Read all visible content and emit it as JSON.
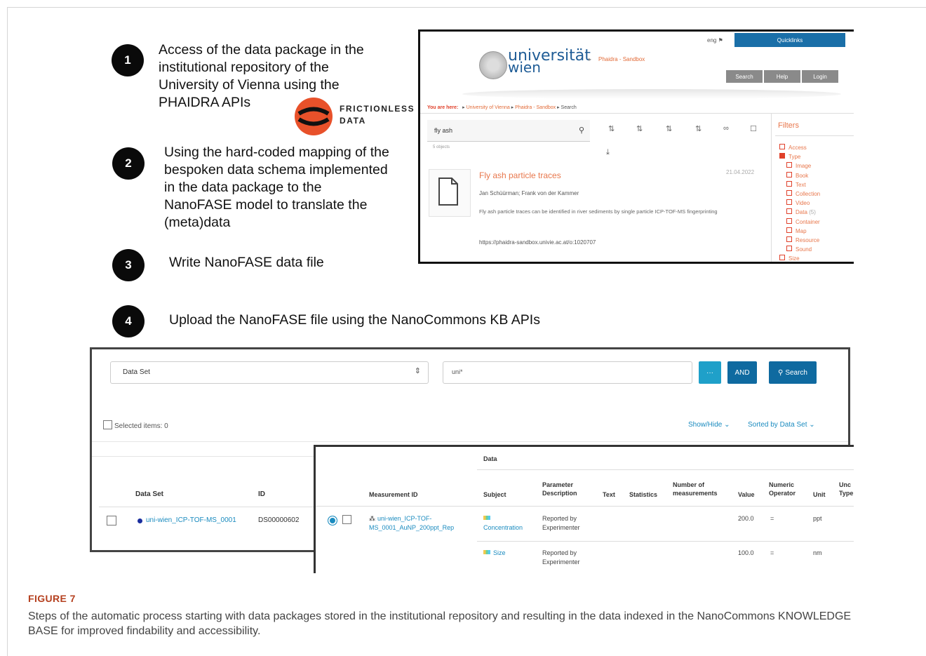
{
  "steps": [
    {
      "num": "1",
      "text": "Access of the data package in the\ninstitutional repository of the\nUniversity of Vienna using the\nPHAIDRA APIs"
    },
    {
      "num": "2",
      "text": "Using the hard-coded mapping of the\nbespoken data schema implemented\nin the data package to the\nNanoFASE model to translate the\n(meta)data"
    },
    {
      "num": "3",
      "text": "Write NanoFASE data file"
    },
    {
      "num": "4",
      "text": "Upload the NanoFASE file using the NanoCommons KB APIs"
    }
  ],
  "frictionless": {
    "line1": "FRICTIONLESS",
    "line2": "DATA"
  },
  "phaidra": {
    "lang": "eng",
    "quicklinks": "Quicklinks",
    "brand_line1": "universität",
    "brand_line2": "wien",
    "crumb_top": "Phaidra - Sandbox",
    "buttons": [
      "Search",
      "Help",
      "Login"
    ],
    "you_are_here": "You are here:",
    "breadcrumb": [
      "University of Vienna",
      "Phaidra - Sandbox",
      "Search"
    ],
    "search_value": "fly ash",
    "objects_count": "5 objects",
    "result": {
      "title": "Fly ash particle traces",
      "date": "21.04.2022",
      "authors": "Jan Schüürman; Frank von der Kammer",
      "description": "Fly ash particle traces can be identified in river sediments by single particle ICP-TOF-MS fingerprinting",
      "url": "https://phaidra-sandbox.univie.ac.at/o:1020707"
    },
    "filters_title": "Filters",
    "filters": [
      {
        "label": "Access",
        "count": "",
        "checked": false,
        "indent": 0
      },
      {
        "label": "Type",
        "count": "",
        "checked": true,
        "indent": 0
      },
      {
        "label": "Image",
        "count": "",
        "checked": false,
        "indent": 1
      },
      {
        "label": "Book",
        "count": "",
        "checked": false,
        "indent": 1
      },
      {
        "label": "Text",
        "count": "",
        "checked": false,
        "indent": 1
      },
      {
        "label": "Collection",
        "count": "",
        "checked": false,
        "indent": 1
      },
      {
        "label": "Video",
        "count": "",
        "checked": false,
        "indent": 1
      },
      {
        "label": "Data",
        "count": "(5)",
        "checked": false,
        "indent": 1
      },
      {
        "label": "Container",
        "count": "",
        "checked": false,
        "indent": 1
      },
      {
        "label": "Map",
        "count": "",
        "checked": false,
        "indent": 1
      },
      {
        "label": "Resource",
        "count": "",
        "checked": false,
        "indent": 1
      },
      {
        "label": "Sound",
        "count": "",
        "checked": false,
        "indent": 1
      },
      {
        "label": "Size",
        "count": "",
        "checked": false,
        "indent": 0
      }
    ]
  },
  "kb": {
    "select_value": "Data Set",
    "search_value": "uni*",
    "btn_more": "···",
    "btn_and": "AND",
    "btn_search": "Search",
    "selected_items": "Selected items: 0",
    "show_hide": "Show/Hide",
    "sorted_by": "Sorted by Data Set",
    "col_dataset": "Data Set",
    "col_id": "ID",
    "row_dataset": "uni-wien_ICP-TOF-MS_0001",
    "row_id": "DS00000602",
    "colors": {
      "button": "#1fa0c9",
      "button_dark": "#0f6aa0",
      "link": "#1a8bbf"
    }
  },
  "data_table": {
    "group_header": "Data",
    "headers": {
      "measurement_id": "Measurement ID",
      "subject": "Subject",
      "param_desc": "Parameter\nDescription",
      "text": "Text",
      "statistics": "Statistics",
      "num_meas": "Number of\nmeasurements",
      "value": "Value",
      "numeric_operator": "Numeric\nOperator",
      "unit": "Unit",
      "unc_type": "Unc\nType"
    },
    "rows": [
      {
        "measurement_id": "uni-wien_ICP-TOF-\nMS_0001_AuNP_200ppt_Rep",
        "subject": "Concentration",
        "param_desc": "Reported by\nExperimenter",
        "value": "200.0",
        "operator": "=",
        "unit": "ppt"
      },
      {
        "measurement_id": "",
        "subject": "Size",
        "param_desc": "Reported by\nExperimenter",
        "value": "100.0",
        "operator": "=",
        "unit": "nm"
      }
    ]
  },
  "caption": {
    "title": "FIGURE 7",
    "text": "Steps of the automatic process starting with data packages stored in the institutional repository and resulting in the data indexed in the NanoCommons KNOWLEDGE BASE for improved findability and accessibility."
  }
}
